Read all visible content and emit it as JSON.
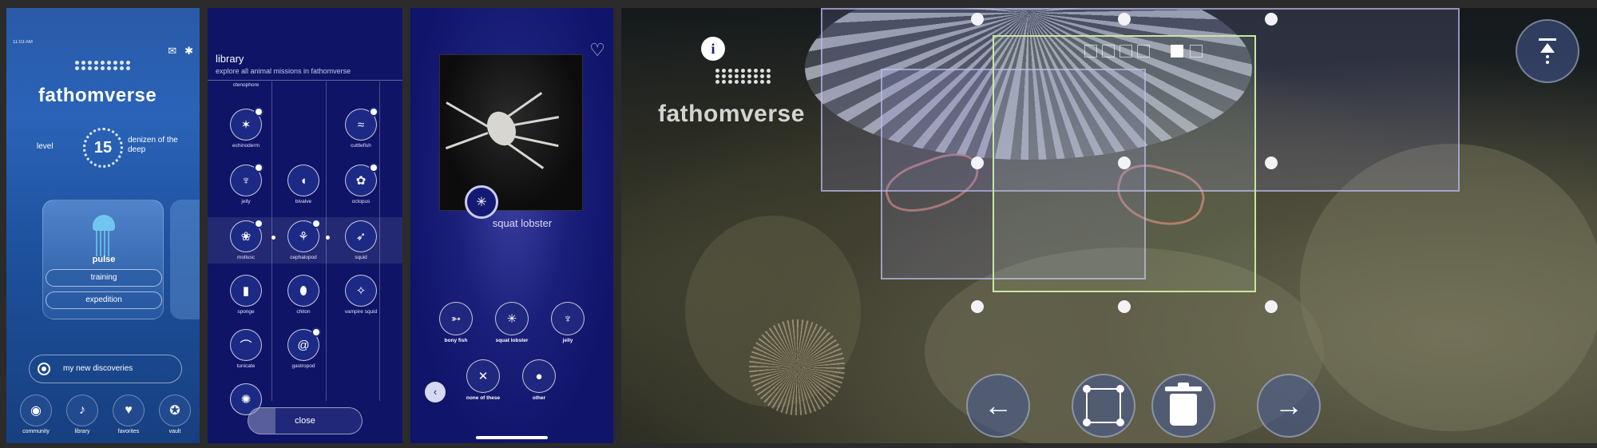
{
  "home": {
    "status": "11:03 AM",
    "brand": "fathomverse",
    "level_label": "level",
    "level_value": "15",
    "rank": "denizen of the deep",
    "card": {
      "title": "pulse",
      "training": "training",
      "expedition": "expedition"
    },
    "discoveries": "my new discoveries",
    "tabs": [
      {
        "label": "community",
        "icon": "discord-icon"
      },
      {
        "label": "library",
        "icon": "microphone-icon"
      },
      {
        "label": "favorites",
        "icon": "heart-icon"
      },
      {
        "label": "vault",
        "icon": "award-icon"
      }
    ]
  },
  "library": {
    "title": "library",
    "subtitle": "explore all animal missions in fathomverse",
    "items": [
      {
        "label": "ctenophore"
      },
      {
        "label": "echinoderm"
      },
      {
        "label": "cuttlefish"
      },
      {
        "label": "jelly"
      },
      {
        "label": "bivalve"
      },
      {
        "label": "octopus"
      },
      {
        "label": "mollusc"
      },
      {
        "label": "cephalopod"
      },
      {
        "label": "squid"
      },
      {
        "label": "sponge"
      },
      {
        "label": "chiton"
      },
      {
        "label": "vampire squid"
      },
      {
        "label": "tunicate"
      },
      {
        "label": "gastropod"
      }
    ],
    "close": "close"
  },
  "detail": {
    "selected": "squat lobster",
    "options": [
      {
        "label": "bony fish"
      },
      {
        "label": "squat lobster"
      },
      {
        "label": "jelly"
      },
      {
        "label": "none of these"
      },
      {
        "label": "other"
      }
    ]
  },
  "annotate": {
    "brand": "fathomverse",
    "info": "i"
  },
  "colors": {
    "library_bg": "#0f1466",
    "home_bg": "#2a5aa8",
    "active_box": "#c9e6a0"
  }
}
